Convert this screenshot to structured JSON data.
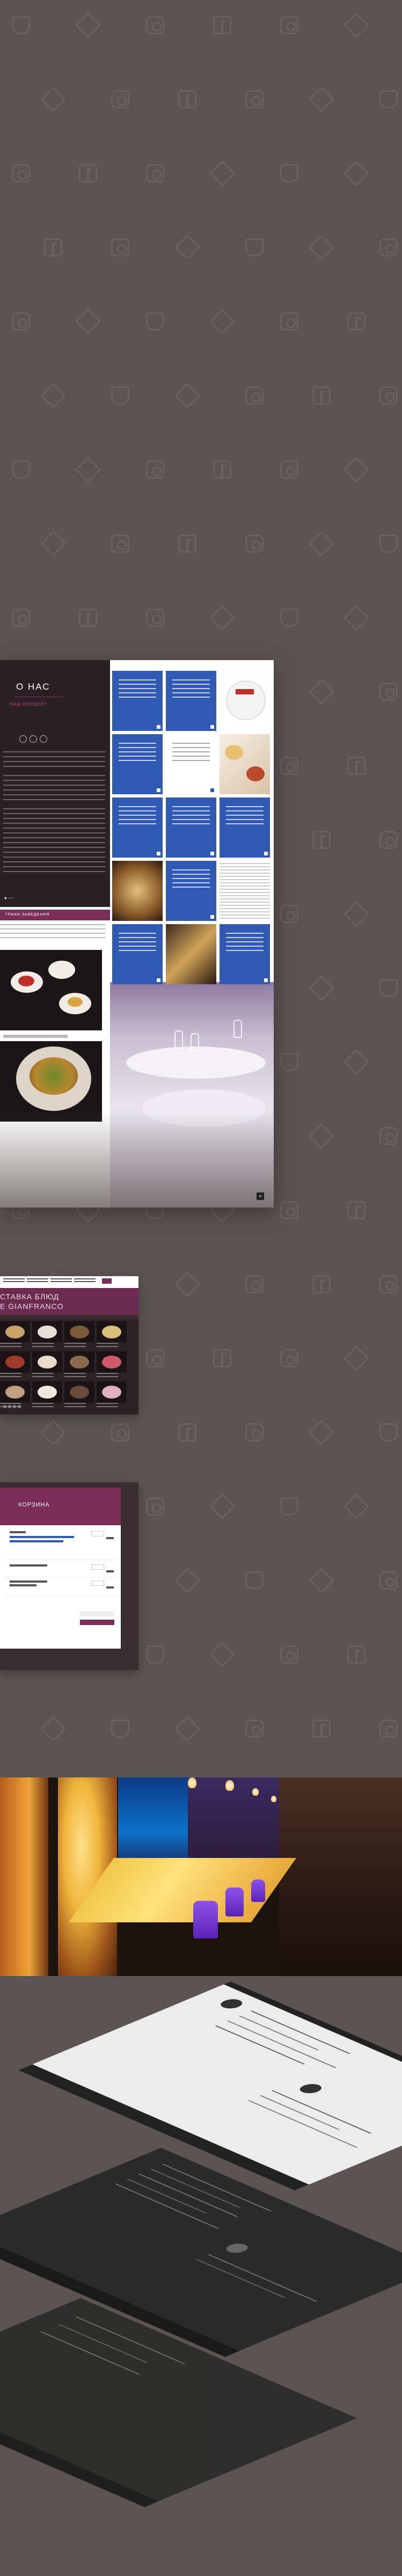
{
  "about": {
    "title": "О НАС",
    "subtitle": "НАШ КОНЦЕПТ"
  },
  "gallery": {
    "bar": "ГРАНИ ЗАВЕДЕНИЯ"
  },
  "menu": {
    "title_line1": "СТАВКА БЛЮД",
    "title_line2": "E GIANFRANCO"
  },
  "cart": {
    "title": "КОРЗИНА"
  },
  "colors": {
    "background": "#5b5452",
    "plum": "#7a2d57",
    "blue": "#2f59b3",
    "dark": "#2a2124"
  }
}
